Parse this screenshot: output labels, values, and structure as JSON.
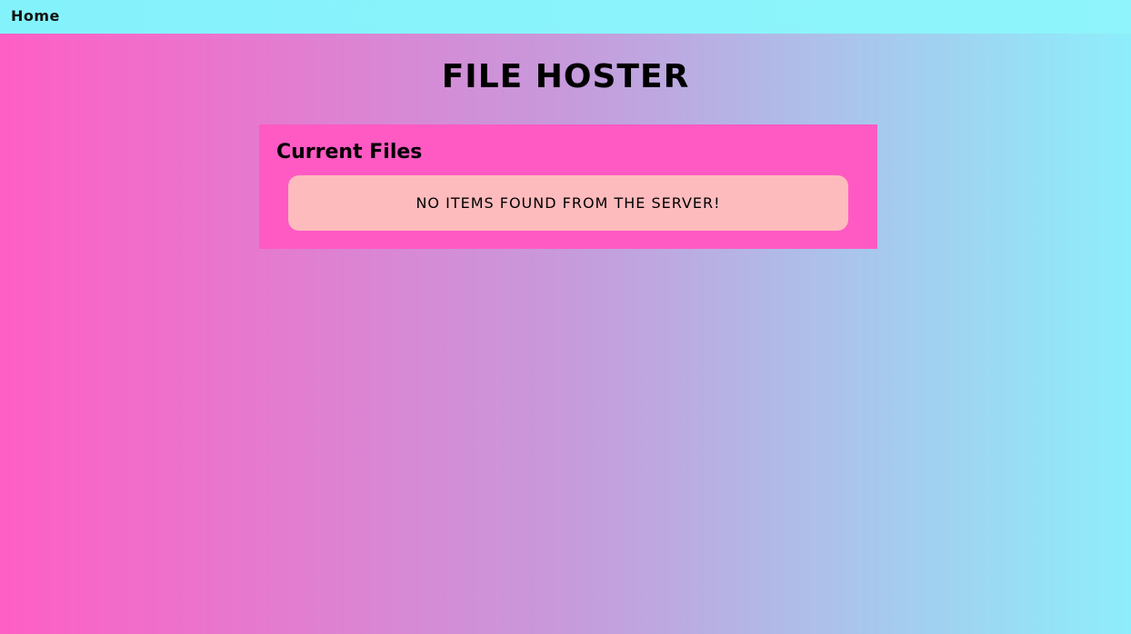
{
  "navbar": {
    "home_label": "Home"
  },
  "page": {
    "title": "FILE HOSTER"
  },
  "files_panel": {
    "title": "Current Files",
    "empty_message": "NO ITEMS FOUND FROM THE SERVER!"
  },
  "colors": {
    "navbar_bg": "#88f3fb",
    "gradient_start": "#ff5ec4",
    "gradient_end": "#8deefb",
    "panel_bg": "#ff5ac3",
    "empty_box_bg": "#febbbd"
  }
}
